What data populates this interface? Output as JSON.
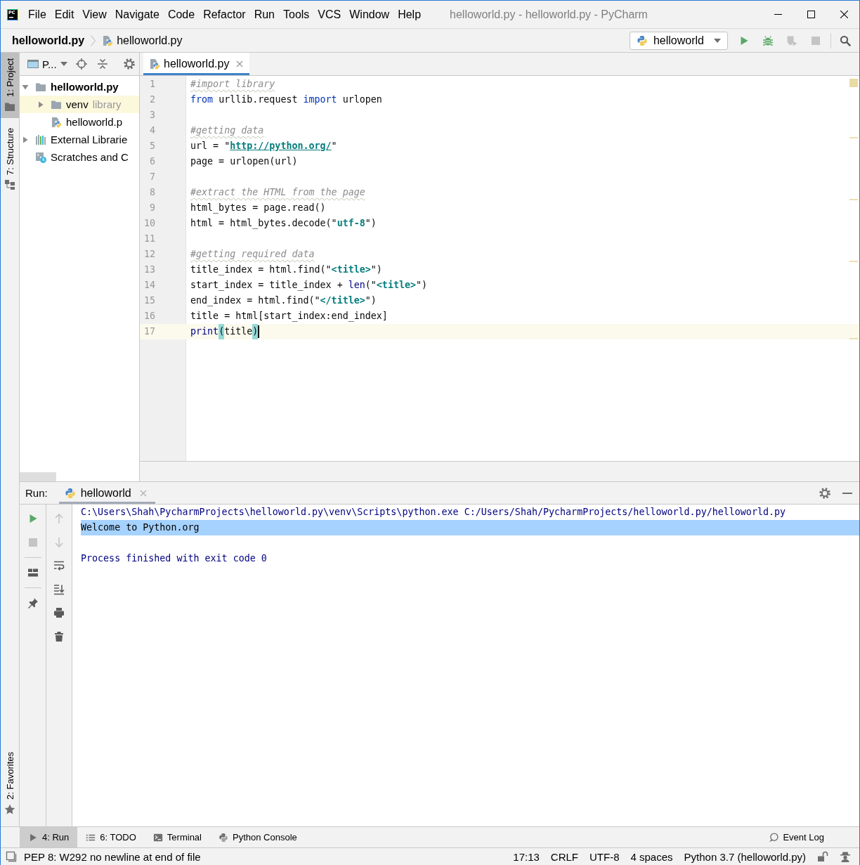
{
  "window": {
    "logo": "PC",
    "menu": [
      "File",
      "Edit",
      "View",
      "Navigate",
      "Code",
      "Refactor",
      "Run",
      "Tools",
      "VCS",
      "Window",
      "Help"
    ],
    "title": "helloworld.py - helloworld.py - PyCharm"
  },
  "navigation_bar": {
    "breadcrumbs": [
      {
        "label": "helloworld.py",
        "kind": "project"
      },
      {
        "label": "helloworld.py",
        "kind": "file"
      }
    ],
    "run_configuration": "helloworld",
    "toolbar": [
      {
        "kind": "run",
        "disabled": false
      },
      {
        "kind": "debug",
        "disabled": false
      },
      {
        "kind": "coverage",
        "disabled": true
      },
      {
        "kind": "stop",
        "disabled": true
      }
    ]
  },
  "tool_window_stripe": {
    "top": [
      {
        "label": "1: Project",
        "kind": "project",
        "selected": true
      },
      {
        "label": "7: Structure",
        "kind": "structure",
        "selected": false
      }
    ],
    "bottom": [
      {
        "label": "2: Favorites",
        "kind": "favorites",
        "selected": false
      }
    ]
  },
  "project_panel": {
    "view_selector": "P...",
    "tree": [
      {
        "label": "helloworld.py",
        "kind": "project-root",
        "expanded": true,
        "highlighted": false,
        "children": [
          {
            "label": "venv",
            "hint": "library",
            "kind": "folder",
            "expanded": false,
            "highlighted": true
          },
          {
            "label": "helloworld.p",
            "kind": "python-file",
            "highlighted": false
          }
        ]
      },
      {
        "label": "External Librarie",
        "kind": "libraries",
        "expanded": false,
        "highlighted": false
      },
      {
        "label": "Scratches and C",
        "kind": "scratches",
        "highlighted": false
      }
    ]
  },
  "editor": {
    "tabs": [
      {
        "label": "helloworld.py",
        "selected": true
      }
    ],
    "lines": [
      {
        "number": "1",
        "current": false,
        "warning": false,
        "tokens": [
          {
            "text": "#import library",
            "kind": "comment"
          }
        ]
      },
      {
        "number": "2",
        "current": false,
        "warning": false,
        "tokens": [
          {
            "text": "from",
            "kind": "keyword"
          },
          {
            "text": " urllib.request ",
            "kind": "plain"
          },
          {
            "text": "import",
            "kind": "keyword"
          },
          {
            "text": " urlopen",
            "kind": "plain"
          }
        ]
      },
      {
        "number": "3",
        "current": false,
        "warning": false
      },
      {
        "number": "4",
        "current": false,
        "warning": true,
        "tokens": [
          {
            "text": "#getting data",
            "kind": "comment"
          }
        ]
      },
      {
        "number": "5",
        "current": false,
        "warning": false,
        "tokens": [
          {
            "text": "url = \"",
            "kind": "plain"
          },
          {
            "text": "http://python.org/",
            "kind": "link"
          },
          {
            "text": "\"",
            "kind": "plain"
          }
        ]
      },
      {
        "number": "6",
        "current": false,
        "warning": false,
        "tokens": [
          {
            "text": "page = urlopen(url)",
            "kind": "plain"
          }
        ]
      },
      {
        "number": "7",
        "current": false,
        "warning": false
      },
      {
        "number": "8",
        "current": false,
        "warning": true,
        "tokens": [
          {
            "text": "#extract the HTML from the page",
            "kind": "comment"
          }
        ]
      },
      {
        "number": "9",
        "current": false,
        "warning": false,
        "tokens": [
          {
            "text": "html_bytes = page.read()",
            "kind": "plain"
          }
        ]
      },
      {
        "number": "10",
        "current": false,
        "warning": false,
        "tokens": [
          {
            "text": "html = html_bytes.decode(\"",
            "kind": "plain"
          },
          {
            "text": "utf-8",
            "kind": "string"
          },
          {
            "text": "\")",
            "kind": "plain"
          }
        ]
      },
      {
        "number": "11",
        "current": false,
        "warning": false
      },
      {
        "number": "12",
        "current": false,
        "warning": true,
        "tokens": [
          {
            "text": "#getting required data",
            "kind": "comment"
          }
        ]
      },
      {
        "number": "13",
        "current": false,
        "warning": false,
        "tokens": [
          {
            "text": "title_index = html.find(\"",
            "kind": "plain"
          },
          {
            "text": "<title>",
            "kind": "string"
          },
          {
            "text": "\")",
            "kind": "plain"
          }
        ]
      },
      {
        "number": "14",
        "current": false,
        "warning": false,
        "tokens": [
          {
            "text": "start_index = title_index + ",
            "kind": "plain"
          },
          {
            "text": "len",
            "kind": "builtin"
          },
          {
            "text": "(\"",
            "kind": "plain"
          },
          {
            "text": "<title>",
            "kind": "string"
          },
          {
            "text": "\")",
            "kind": "plain"
          }
        ]
      },
      {
        "number": "15",
        "current": false,
        "warning": false,
        "tokens": [
          {
            "text": "end_index = html.find(\"",
            "kind": "plain"
          },
          {
            "text": "</title>",
            "kind": "string"
          },
          {
            "text": "\")",
            "kind": "plain"
          }
        ]
      },
      {
        "number": "16",
        "current": false,
        "warning": false,
        "tokens": [
          {
            "text": "title = html[start_index:end_index]",
            "kind": "plain"
          }
        ]
      },
      {
        "number": "17",
        "current": true,
        "warning": true,
        "tokens": [
          {
            "text": "print",
            "kind": "builtin"
          },
          {
            "text": "(",
            "kind": "brace-match"
          },
          {
            "text": "title",
            "kind": "plain"
          },
          {
            "text": ")",
            "kind": "brace-match"
          }
        ]
      }
    ]
  },
  "run_panel": {
    "label": "Run:",
    "tabs": [
      {
        "label": "helloworld",
        "selected": true
      }
    ],
    "left_toolbar": [
      {
        "kind": "rerun",
        "disabled": false
      },
      {
        "kind": "stop",
        "disabled": true
      },
      {
        "kind": "layout",
        "disabled": false
      },
      {
        "kind": "pin",
        "disabled": false
      }
    ],
    "right_toolbar": [
      {
        "kind": "previous",
        "disabled": true
      },
      {
        "kind": "next",
        "disabled": true
      },
      {
        "kind": "soft-wrap",
        "disabled": false
      },
      {
        "kind": "scroll-to-end",
        "disabled": false
      },
      {
        "kind": "print",
        "disabled": false
      },
      {
        "kind": "clear",
        "disabled": false
      }
    ],
    "console": [
      {
        "text": "C:\\Users\\Shah\\PycharmProjects\\helloworld.py\\venv\\Scripts\\python.exe C:/Users/Shah/PycharmProjects/helloworld.py/helloworld.py",
        "kind": "command",
        "selected": false
      },
      {
        "text": "Welcome to Python.org",
        "kind": "output",
        "selected": true
      },
      {
        "text": "Process finished with exit code 0",
        "kind": "exit",
        "selected": false
      }
    ]
  },
  "tool_window_bar": {
    "left": [
      {
        "label": "4: Run",
        "kind": "run",
        "selected": true
      },
      {
        "label": "6: TODO",
        "kind": "todo",
        "selected": false
      },
      {
        "label": "Terminal",
        "kind": "terminal",
        "selected": false
      },
      {
        "label": "Python Console",
        "kind": "python-console",
        "selected": false
      }
    ],
    "right": [
      {
        "label": "Event Log",
        "kind": "event-log",
        "selected": false
      }
    ]
  },
  "status_bar": {
    "message": "PEP 8: W292 no newline at end of file",
    "widgets": [
      "17:13",
      "CRLF",
      "UTF-8",
      "4 spaces",
      "Python 3.7 (helloworld.py)"
    ]
  }
}
